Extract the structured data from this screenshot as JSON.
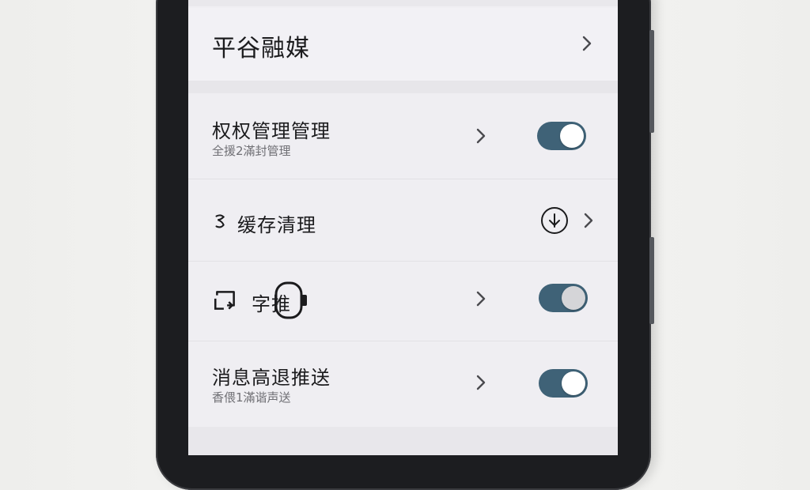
{
  "header": {
    "title": "平谷融媒"
  },
  "settings": [
    {
      "title": "权权管理管理",
      "subtitle": "全援2滿封管理",
      "toggle_on": true
    },
    {
      "title": "缓存清理"
    },
    {
      "title": "字推",
      "toggle_on": true
    },
    {
      "title": "消息高退推送",
      "subtitle": "香偎1滿谐声送",
      "toggle_on": true
    }
  ],
  "colors": {
    "toggle_track": "#3f6277",
    "screen_bg": "#f0eff3",
    "phone_frame": "#1c1d20"
  }
}
